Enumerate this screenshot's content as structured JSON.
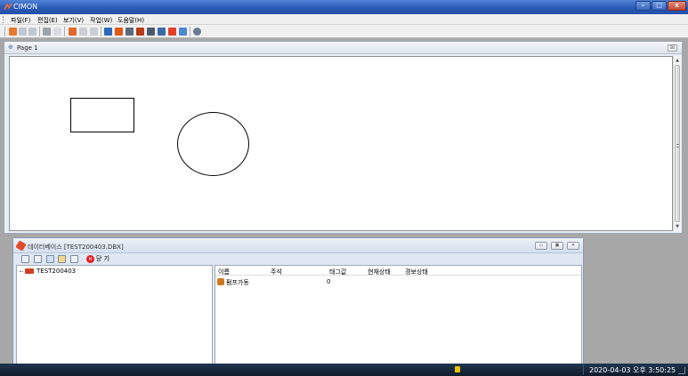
{
  "window": {
    "title": "CIMON"
  },
  "menu": [
    {
      "label": "파일(F)"
    },
    {
      "label": "편집(E)"
    },
    {
      "label": "보기(V)"
    },
    {
      "label": "작업(W)"
    },
    {
      "label": "도움말(H)"
    }
  ],
  "toolbar": {
    "icons": [
      "home-icon",
      "open-icon",
      "save-icon",
      "print-icon",
      "cut-icon",
      "copy-icon",
      "paste-icon",
      "monitor-icon",
      "pencil-icon",
      "network-icon",
      "user-icon",
      "document-icon",
      "table-icon",
      "chart-icon",
      "image-icon",
      "help-icon"
    ]
  },
  "page": {
    "title": "Page 1",
    "close_label": "☒"
  },
  "database": {
    "title": "데이터베이스 [TEST200403.DBX]",
    "close_label": "닫 기",
    "tree": [
      {
        "label": "TEST200403"
      }
    ],
    "columns": [
      "이름",
      "주석",
      "태그값",
      "현재상태",
      "경보상태"
    ],
    "rows": [
      {
        "name": "펌프가동",
        "comment": "",
        "value": "0",
        "status": "",
        "alarm": ""
      }
    ]
  },
  "taskbar": {
    "clock": "2020-04-03 오후 3:50:25"
  },
  "colors": {
    "titlebar": "#2a5ab5",
    "taskbar": "#101c2b",
    "canvas": "#ffffff"
  }
}
